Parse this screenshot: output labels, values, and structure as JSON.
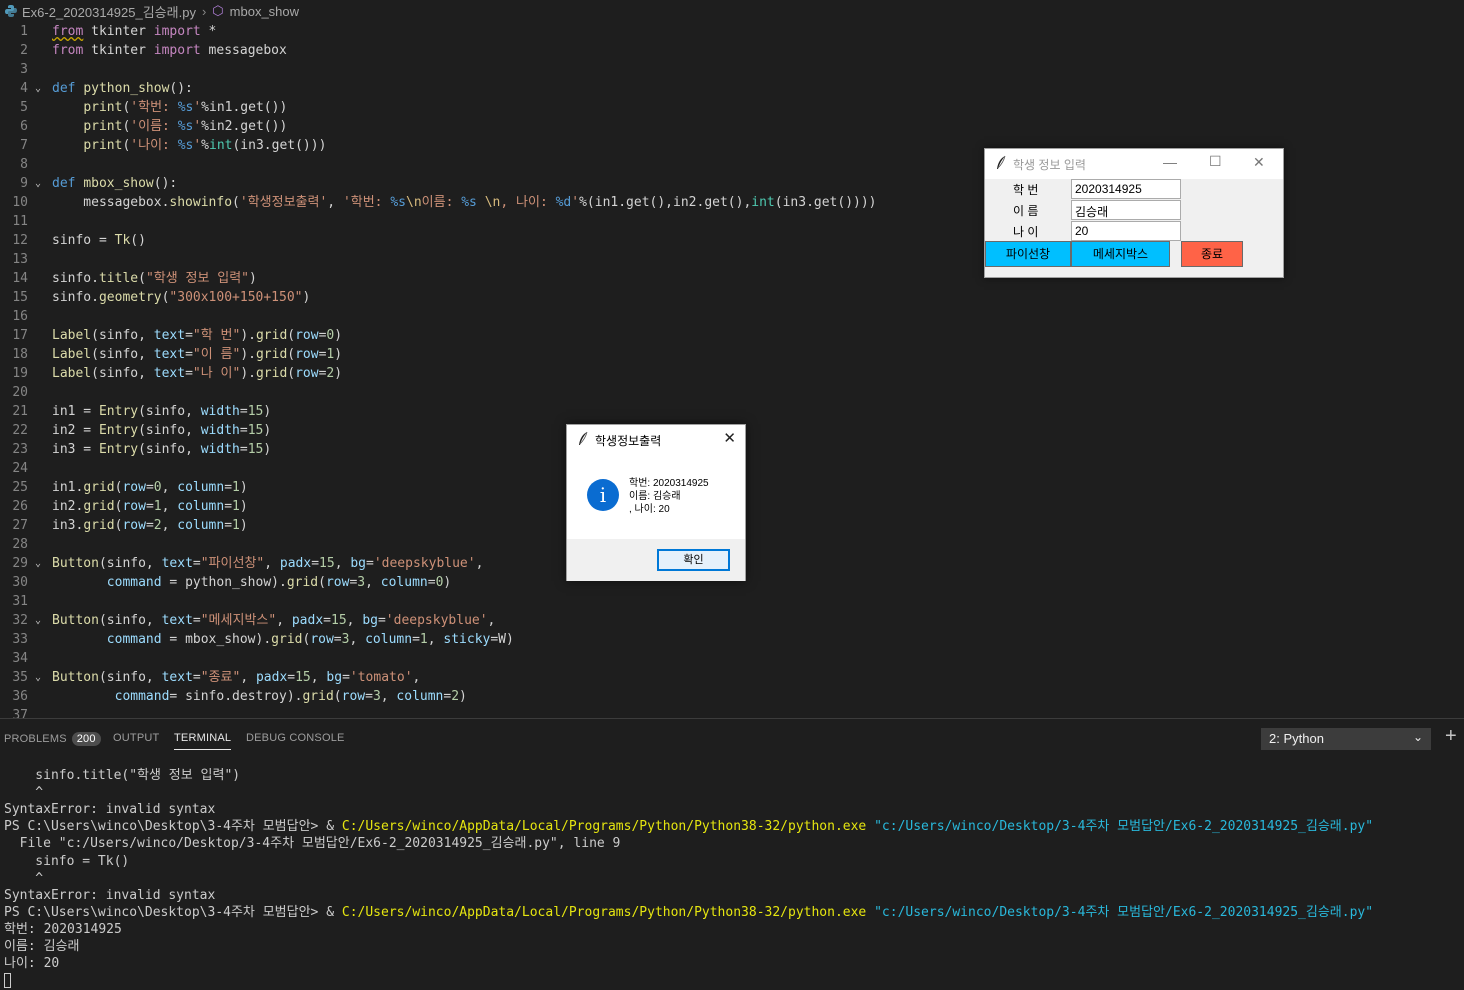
{
  "breadcrumb": {
    "file": "Ex6-2_2020314925_김승래.py",
    "symbol": "mbox_show"
  },
  "editor": {
    "lines": [
      {
        "n": "1",
        "html": "<span class='kw ul'>from</span> tkinter <span class='kw'>import</span> *"
      },
      {
        "n": "2",
        "html": "<span class='kw'>from</span> tkinter <span class='kw'>import</span> messagebox"
      },
      {
        "n": "3",
        "html": ""
      },
      {
        "n": "4",
        "fold": true,
        "html": "<span class='bl'>def</span> <span class='fn'>python_show</span>():"
      },
      {
        "n": "5",
        "html": "    <span class='fn'>print</span>(<span class='str'>'학번: </span><span class='bl'>%s</span><span class='str'>'</span>%in1.get())"
      },
      {
        "n": "6",
        "html": "    <span class='fn'>print</span>(<span class='str'>'이름: </span><span class='bl'>%s</span><span class='str'>'</span>%in2.get())"
      },
      {
        "n": "7",
        "html": "    <span class='fn'>print</span>(<span class='str'>'나이: </span><span class='bl'>%s</span><span class='str'>'</span>%<span class='cls'>int</span>(in3.get()))"
      },
      {
        "n": "8",
        "html": ""
      },
      {
        "n": "9",
        "fold": true,
        "html": "<span class='bl'>def</span> <span class='fn'>mbox_show</span>():"
      },
      {
        "n": "10",
        "html": "    messagebox.<span class='fn'>showinfo</span>(<span class='str'>'학생정보출력'</span>, <span class='str'>'학번: </span><span class='bl'>%s</span><span class='esc'>\\n</span><span class='str'>이름: </span><span class='bl'>%s</span><span class='str'> </span><span class='esc'>\\n</span><span class='str'>, 나이: </span><span class='bl'>%d</span><span class='str'>'</span>%(in1.get(),in2.get(),<span class='cls'>int</span>(in3.get())))"
      },
      {
        "n": "11",
        "html": ""
      },
      {
        "n": "12",
        "html": "sinfo = <span class='fn'>Tk</span>()"
      },
      {
        "n": "13",
        "html": ""
      },
      {
        "n": "14",
        "html": "sinfo.<span class='fn'>title</span>(<span class='str'>\"학생 정보 입력\"</span>)"
      },
      {
        "n": "15",
        "html": "sinfo.<span class='fn'>geometry</span>(<span class='str'>\"300x100+150+150\"</span>)"
      },
      {
        "n": "16",
        "html": ""
      },
      {
        "n": "17",
        "html": "<span class='fn'>Label</span>(sinfo, <span class='pm'>text</span>=<span class='str'>\"학 번\"</span>).<span class='fn'>grid</span>(<span class='pm'>row</span>=<span class='num'>0</span>)"
      },
      {
        "n": "18",
        "html": "<span class='fn'>Label</span>(sinfo, <span class='pm'>text</span>=<span class='str'>\"이 름\"</span>).<span class='fn'>grid</span>(<span class='pm'>row</span>=<span class='num'>1</span>)"
      },
      {
        "n": "19",
        "html": "<span class='fn'>Label</span>(sinfo, <span class='pm'>text</span>=<span class='str'>\"나 이\"</span>).<span class='fn'>grid</span>(<span class='pm'>row</span>=<span class='num'>2</span>)"
      },
      {
        "n": "20",
        "html": ""
      },
      {
        "n": "21",
        "html": "in1 = <span class='fn'>Entry</span>(sinfo, <span class='pm'>width</span>=<span class='num'>15</span>)"
      },
      {
        "n": "22",
        "html": "in2 = <span class='fn'>Entry</span>(sinfo, <span class='pm'>width</span>=<span class='num'>15</span>)"
      },
      {
        "n": "23",
        "html": "in3 = <span class='fn'>Entry</span>(sinfo, <span class='pm'>width</span>=<span class='num'>15</span>)"
      },
      {
        "n": "24",
        "html": ""
      },
      {
        "n": "25",
        "html": "in1.<span class='fn'>grid</span>(<span class='pm'>row</span>=<span class='num'>0</span>, <span class='pm'>column</span>=<span class='num'>1</span>)"
      },
      {
        "n": "26",
        "html": "in2.<span class='fn'>grid</span>(<span class='pm'>row</span>=<span class='num'>1</span>, <span class='pm'>column</span>=<span class='num'>1</span>)"
      },
      {
        "n": "27",
        "html": "in3.<span class='fn'>grid</span>(<span class='pm'>row</span>=<span class='num'>2</span>, <span class='pm'>column</span>=<span class='num'>1</span>)"
      },
      {
        "n": "28",
        "html": ""
      },
      {
        "n": "29",
        "fold": true,
        "html": "<span class='fn'>Button</span>(sinfo, <span class='pm'>text</span>=<span class='str'>\"파이선창\"</span>, <span class='pm'>padx</span>=<span class='num'>15</span>, <span class='pm'>bg</span>=<span class='str'>'deepskyblue'</span>,"
      },
      {
        "n": "30",
        "html": "       <span class='pm'>command</span> = python_show).<span class='fn'>grid</span>(<span class='pm'>row</span>=<span class='num'>3</span>, <span class='pm'>column</span>=<span class='num'>0</span>)"
      },
      {
        "n": "31",
        "html": ""
      },
      {
        "n": "32",
        "fold": true,
        "html": "<span class='fn'>Button</span>(sinfo, <span class='pm'>text</span>=<span class='str'>\"메세지박스\"</span>, <span class='pm'>padx</span>=<span class='num'>15</span>, <span class='pm'>bg</span>=<span class='str'>'deepskyblue'</span>,"
      },
      {
        "n": "33",
        "html": "       <span class='pm'>command</span> = mbox_show).<span class='fn'>grid</span>(<span class='pm'>row</span>=<span class='num'>3</span>, <span class='pm'>column</span>=<span class='num'>1</span>, <span class='pm'>sticky</span>=W)"
      },
      {
        "n": "34",
        "html": ""
      },
      {
        "n": "35",
        "fold": true,
        "html": "<span class='fn'>Button</span>(sinfo, <span class='pm'>text</span>=<span class='str'>\"종료\"</span>, <span class='pm'>padx</span>=<span class='num'>15</span>, <span class='pm'>bg</span>=<span class='str'>'tomato'</span>,"
      },
      {
        "n": "36",
        "html": "        <span class='pm'>command</span>= sinfo.destroy).<span class='fn'>grid</span>(<span class='pm'>row</span>=<span class='num'>3</span>, <span class='pm'>column</span>=<span class='num'>2</span>)"
      },
      {
        "n": "37",
        "html": ""
      }
    ]
  },
  "panel": {
    "tabs": {
      "problems": "PROBLEMS",
      "problems_count": "200",
      "output": "OUTPUT",
      "terminal": "TERMINAL",
      "debug": "DEBUG CONSOLE"
    },
    "terminal_select": "2: Python",
    "terminal_lines": [
      {
        "html": "    sinfo.title(\"학생 정보 입력\")"
      },
      {
        "html": "    ^"
      },
      {
        "html": "SyntaxError: invalid syntax"
      },
      {
        "html": "PS C:\\Users\\winco\\Desktop\\3-4주차 모범답안> &amp; <span class='y'>C:/Users/winco/AppData/Local/Programs/Python/Python38-32/python.exe</span> <span class='c'>\"c:/Users/winco/Desktop/3-4주차 모범답안/Ex6-2_2020314925_김승래.py\"</span>"
      },
      {
        "html": "  File \"c:/Users/winco/Desktop/3-4주차 모범답안/Ex6-2_2020314925_김승래.py\", line 9"
      },
      {
        "html": "    sinfo = Tk()"
      },
      {
        "html": "    ^"
      },
      {
        "html": "SyntaxError: invalid syntax"
      },
      {
        "html": "PS C:\\Users\\winco\\Desktop\\3-4주차 모범답안> &amp; <span class='y'>C:/Users/winco/AppData/Local/Programs/Python/Python38-32/python.exe</span> <span class='c'>\"c:/Users/winco/Desktop/3-4주차 모범답안/Ex6-2_2020314925_김승래.py\"</span>"
      },
      {
        "html": "학번: 2020314925"
      },
      {
        "html": "이름: 김승래"
      },
      {
        "html": "나이: 20"
      }
    ]
  },
  "tk_window": {
    "title": "학생 정보 입력",
    "labels": [
      "학 번",
      "이 름",
      "나 이"
    ],
    "entries": [
      "2020314925",
      "김승래",
      "20"
    ],
    "buttons": {
      "python": "파이선창",
      "mbox": "메세지박스",
      "quit": "종료"
    },
    "colors": {
      "deepskyblue": "#00bfff",
      "tomato": "#ff6347"
    }
  },
  "messagebox": {
    "title": "학생정보출력",
    "icon": "i",
    "line1": "학번: 2020314925",
    "line2": "이름: 김승래",
    "line3": ", 나이: 20",
    "ok": "확인"
  }
}
